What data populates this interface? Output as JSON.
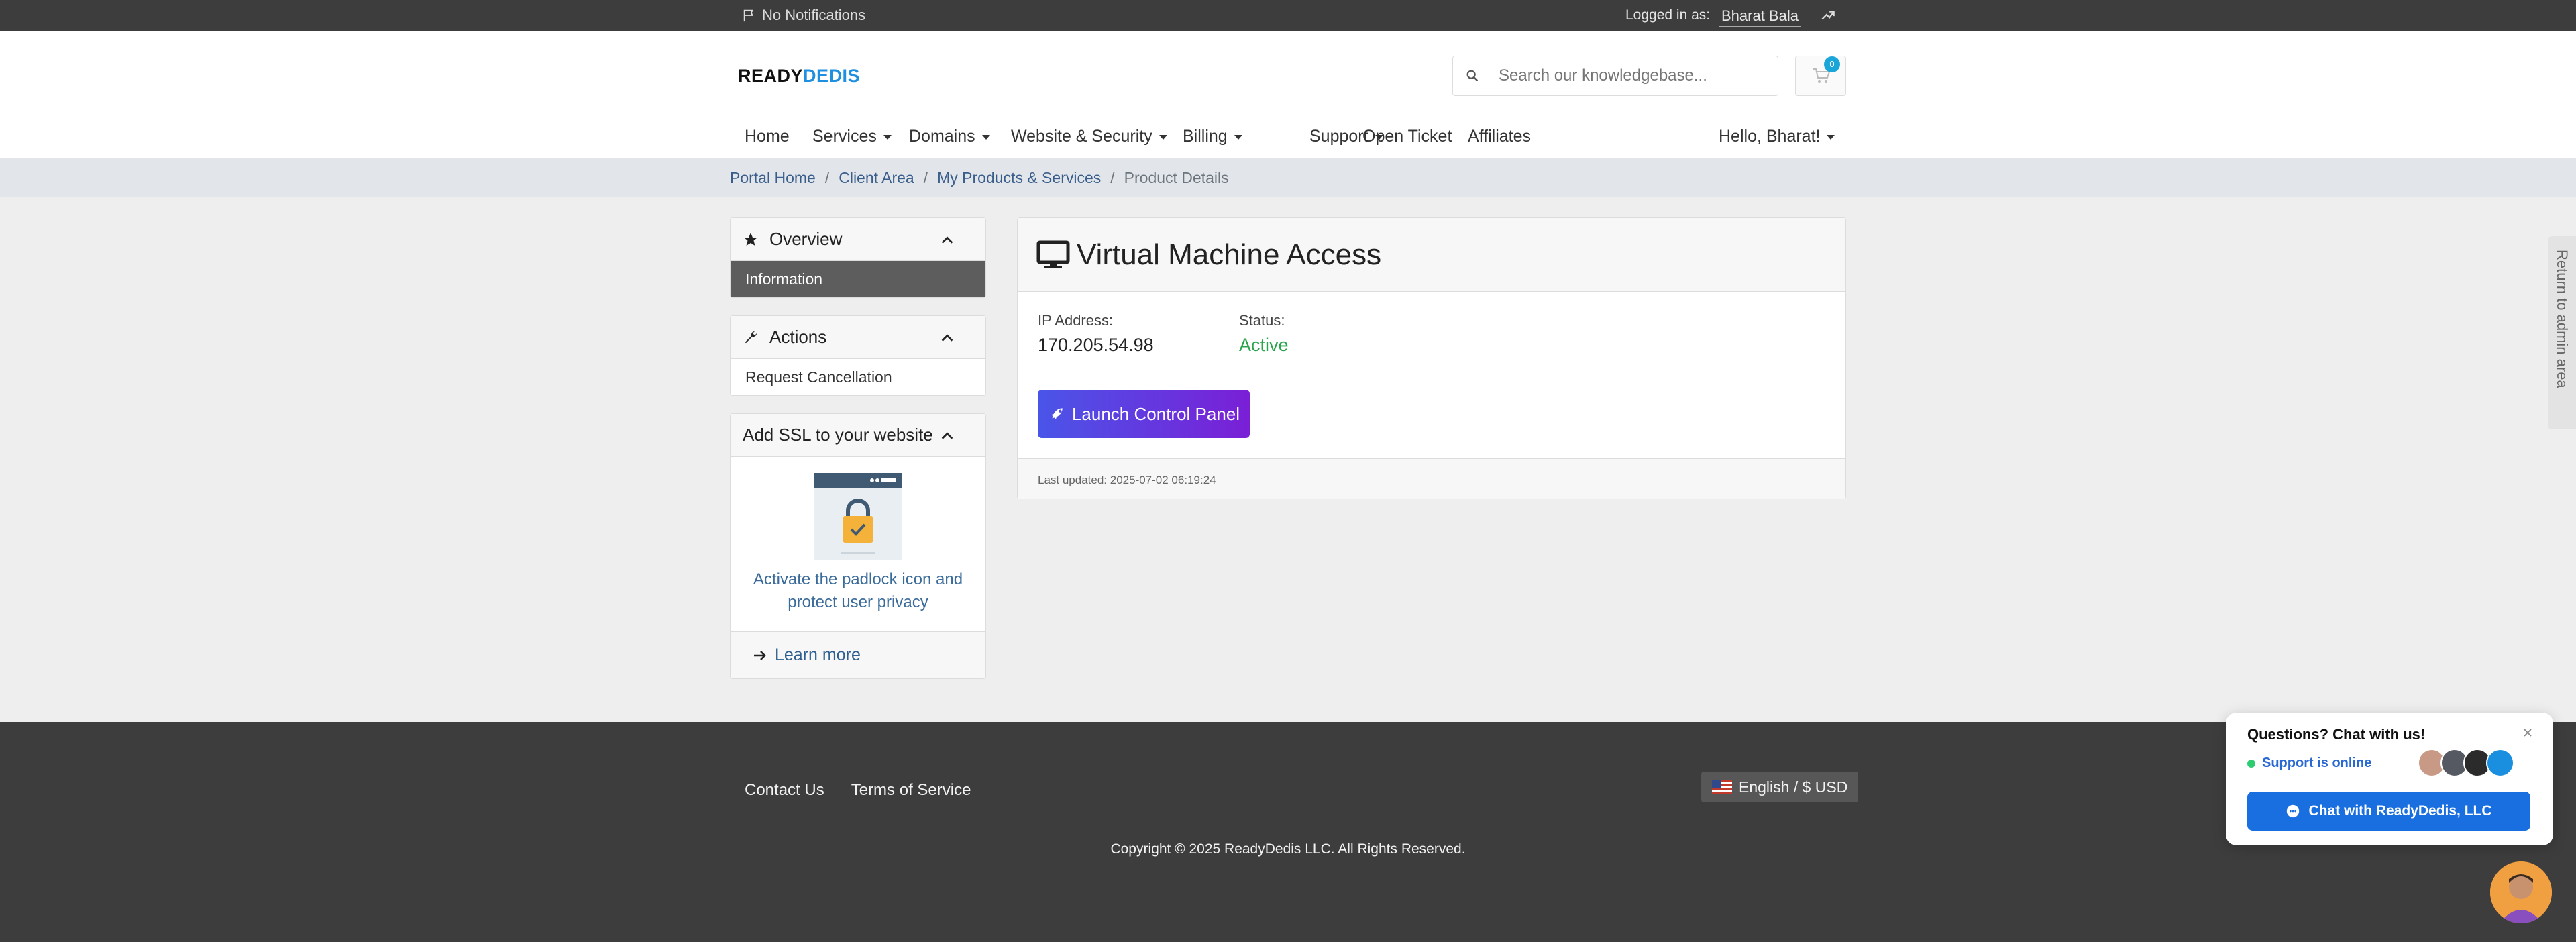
{
  "topbar": {
    "notifications": "No Notifications",
    "logged_in_as": "Logged in as:",
    "user": "Bharat Bala"
  },
  "header": {
    "logo_part1": "READY",
    "logo_part2": "DEDIS",
    "search_placeholder": "Search our knowledgebase...",
    "cart_count": "0"
  },
  "nav": {
    "items": [
      "Home",
      "Services",
      "Domains",
      "Website & Security",
      "Billing",
      "Support",
      "Open Ticket",
      "Affiliates"
    ],
    "greeting": "Hello, Bharat!"
  },
  "breadcrumb": [
    "Portal Home",
    "Client Area",
    "My Products & Services",
    "Product Details"
  ],
  "sidebar": {
    "overview_title": "Overview",
    "overview_item": "Information",
    "actions_title": "Actions",
    "actions_item": "Request Cancellation",
    "ssl_title": "Add SSL to your website",
    "ssl_text": "Activate the padlock icon and protect user privacy",
    "learn_more": "Learn more"
  },
  "main": {
    "title": "Virtual Machine Access",
    "ip_label": "IP Address:",
    "ip_value": "170.205.54.98",
    "status_label": "Status:",
    "status_value": "Active",
    "launch_button": "Launch Control Panel",
    "last_updated": "Last updated: 2025-07-02 06:19:24"
  },
  "admin_tab": "Return to admin area",
  "footer": {
    "links": [
      "Contact Us",
      "Terms of Service"
    ],
    "language": "English / $ USD",
    "copyright": "Copyright © 2025 ReadyDedis LLC. All Rights Reserved."
  },
  "chat": {
    "question": "Questions? Chat with us!",
    "status": "Support is online",
    "button": "Chat with ReadyDedis, LLC"
  },
  "colors": {
    "topbar": "#3d3d3d",
    "link": "#3a5e8c",
    "active_status": "#2aa44c",
    "launch_gradient_start": "#4a55e8",
    "launch_gradient_end": "#7a1fd6",
    "chat_button": "#1a6fe0"
  }
}
